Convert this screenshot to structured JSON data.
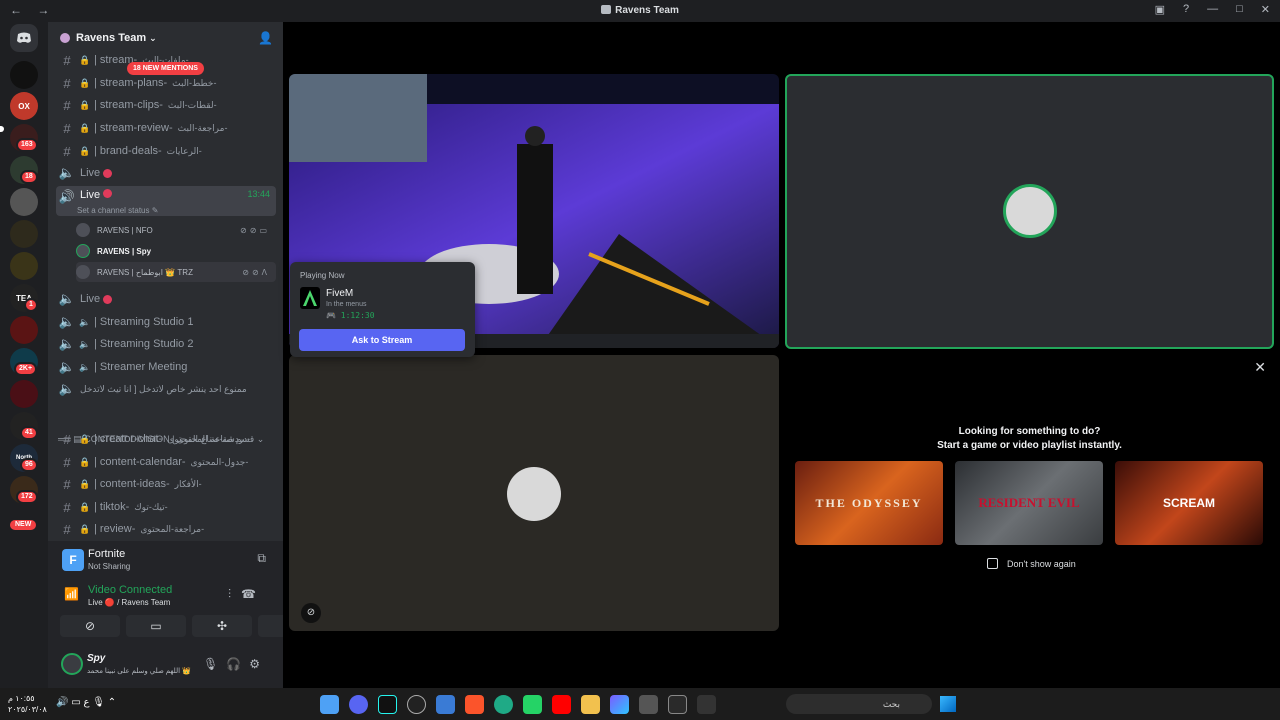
{
  "window": {
    "title": "Ravens Team"
  },
  "guild": {
    "name": "Ravens Team",
    "new_mentions": "18 NEW MENTIONS"
  },
  "rail": {
    "badges": [
      "163",
      "18",
      "1",
      "2K+",
      "41",
      "96",
      "172"
    ],
    "new_label": "NEW",
    "server_texts": [
      "OX",
      "TEA",
      "North"
    ]
  },
  "channels": {
    "stream_top": "| stream-",
    "stream_top_ar": "ملفات-البث-",
    "stream_plans": "| stream-plans-",
    "stream_plans_ar": "خطط-البث-",
    "stream_clips": "| stream-clips-",
    "stream_clips_ar": "لقطات-البث-",
    "stream_review": "| stream-review-",
    "stream_review_ar": "مراجعة-البث-",
    "brand_deals": "| brand-deals-",
    "brand_deals_ar": "الرعايات-",
    "live1": "Live",
    "live_active": "Live",
    "live_timer": "13:44",
    "live_status": "Set a channel status",
    "members": [
      {
        "name": "RAVENS | NFO"
      },
      {
        "name": "RAVENS | Spy"
      },
      {
        "name": "RAVENS | ابوطماح 👑 TRZ"
      }
    ],
    "live2": "Live",
    "studio1": "| Streaming Studio 1",
    "studio2": "| Streaming Studio 2",
    "streamer_meeting": "| Streamer Meeting",
    "locked_voice": "ممنوع احد ينشر خاص لاتدخل [ انا تيث لاتدخل",
    "category": "CONTENT DIVISION | قسم صناعة المحتوى",
    "creator_chat": "| creator-chat-",
    "creator_chat_ar": "دردشة-صناع-المحتوى-",
    "content_calendar": "| content-calendar-",
    "content_calendar_ar": "جدول-المحتوى-",
    "content_ideas": "| content-ideas-",
    "content_ideas_ar": "الأفكار-",
    "tiktok": "| tiktok-",
    "tiktok_ar": "تيك-توك-",
    "review": "| review-",
    "review_ar": "مراجعة-المحتوى-"
  },
  "activity": {
    "name": "Fortnite",
    "status": "Not Sharing"
  },
  "voice": {
    "status": "Video Connected",
    "channel": "Live 🔴 / Ravens Team"
  },
  "user": {
    "name": "Spy",
    "status": "اللهم صلي وسلم على نبينا محمد 👑"
  },
  "popup": {
    "header": "Playing Now",
    "game": "FiveM",
    "sub": "In the menus",
    "time": "1:12:30",
    "button": "Ask to Stream"
  },
  "promo": {
    "line1": "Looking for something to do?",
    "line2": "Start a game or video playlist instantly.",
    "cards": [
      "THE ODYSSEY",
      "RESIDENT EVIL",
      "SCREAM"
    ],
    "dont_show": "Don't show again"
  },
  "taskbar": {
    "time": "١٠:٥٥ م",
    "date": "٢٠٢٥/٠٣/٠٨",
    "search": "بحث"
  },
  "colors": {
    "accent": "#5865f2",
    "online": "#23a55a",
    "danger": "#f23f43"
  }
}
